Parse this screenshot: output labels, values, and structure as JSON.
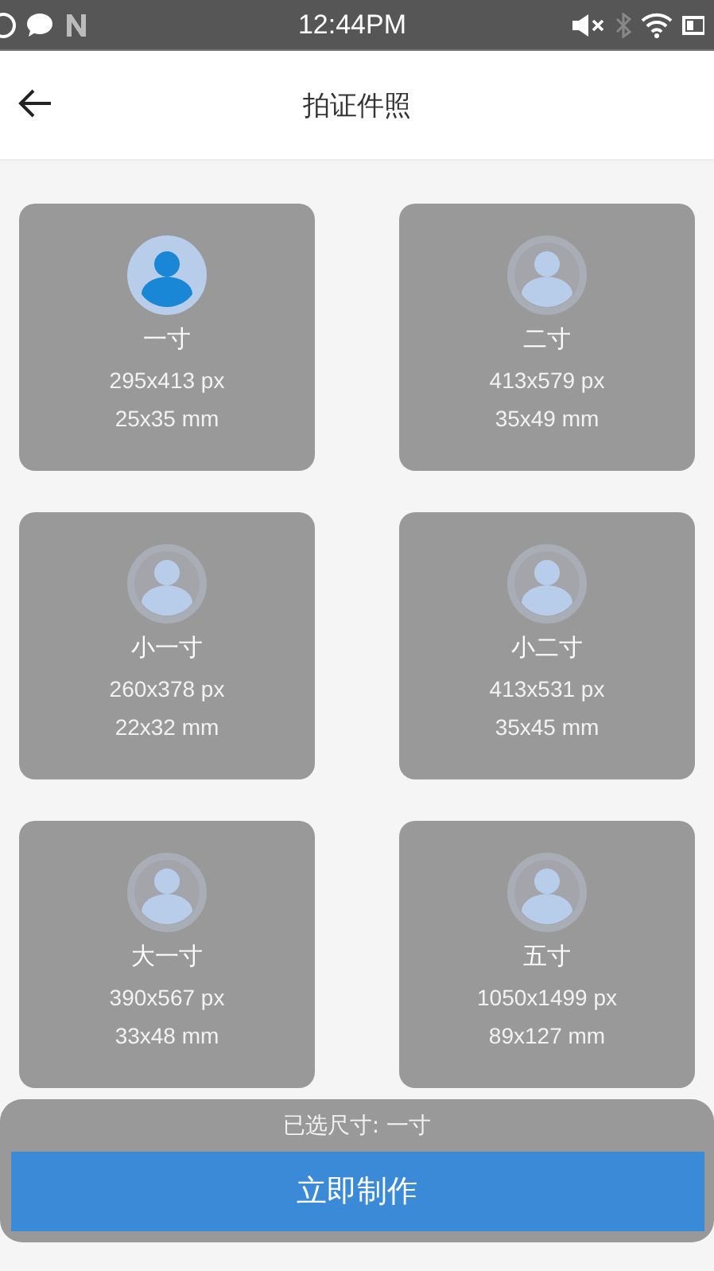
{
  "status_bar": {
    "time": "12:44PM"
  },
  "header": {
    "title": "拍证件照"
  },
  "sizes": [
    {
      "name": "一寸",
      "pixels": "295x413 px",
      "mm": "25x35 mm",
      "selected": true
    },
    {
      "name": "二寸",
      "pixels": "413x579 px",
      "mm": "35x49 mm",
      "selected": false
    },
    {
      "name": "小一寸",
      "pixels": "260x378 px",
      "mm": "22x32 mm",
      "selected": false
    },
    {
      "name": "小二寸",
      "pixels": "413x531 px",
      "mm": "35x45 mm",
      "selected": false
    },
    {
      "name": "大一寸",
      "pixels": "390x567 px",
      "mm": "33x48 mm",
      "selected": false
    },
    {
      "name": "五寸",
      "pixels": "1050x1499 px",
      "mm": "89x127 mm",
      "selected": false
    }
  ],
  "footer": {
    "selected_label": "已选尺寸: 一寸",
    "button": "立即制作"
  }
}
